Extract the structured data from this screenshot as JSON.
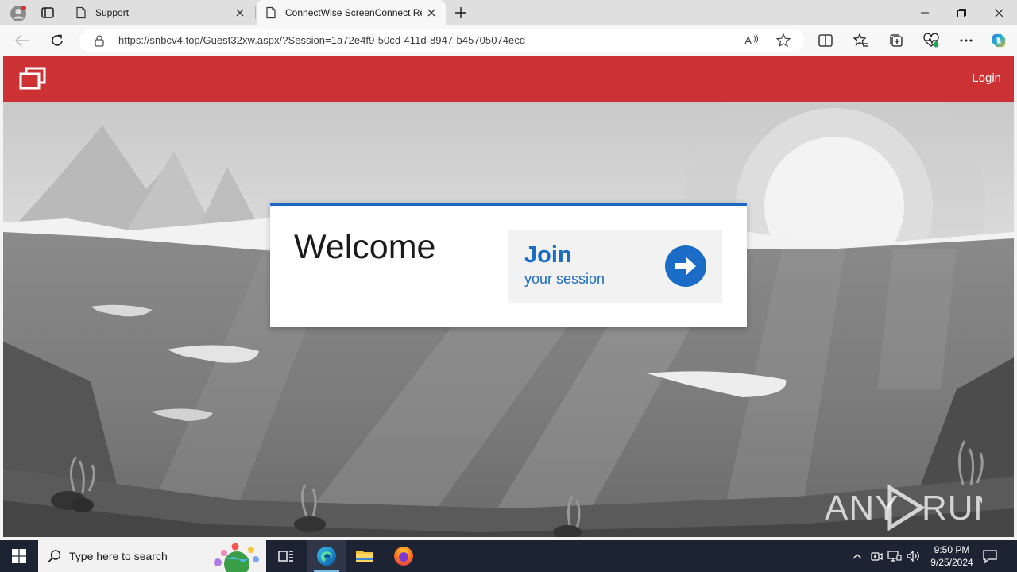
{
  "browser": {
    "tabs": [
      {
        "title": "Support",
        "active": false
      },
      {
        "title": "ConnectWise ScreenConnect Remote Support",
        "active": true
      }
    ],
    "address": {
      "url": "https://snbcv4.top/Guest32xw.aspx/?Session=1a72e4f9-50cd-411d-8947-b45705074ecd"
    },
    "icons": {
      "profile": "profile-icon",
      "tab_actions": "tab-actions-icon",
      "page": "page-icon",
      "close": "close-icon",
      "new_tab": "plus-icon",
      "back": "back-arrow-icon",
      "refresh": "refresh-icon",
      "lock": "lock-icon",
      "read_aloud": "read-aloud-icon",
      "favorite": "star-icon",
      "split_screen": "split-screen-icon",
      "favorites": "favorites-icon",
      "collections": "collections-icon",
      "browser_essentials": "heart-pulse-icon",
      "more": "more-icon",
      "copilot": "copilot-icon"
    }
  },
  "page": {
    "header": {
      "login_label": "Login",
      "color": "#cc3233"
    },
    "welcome_title": "Welcome",
    "join": {
      "title": "Join",
      "subtitle": "your session",
      "color": "#1a6cc6"
    },
    "watermark": "ANY RUN"
  },
  "taskbar": {
    "search_placeholder": "Type here to search",
    "apps": [
      "Task View",
      "Microsoft Edge",
      "File Explorer",
      "Firefox"
    ],
    "time": "9:50 PM",
    "date": "9/25/2024"
  }
}
